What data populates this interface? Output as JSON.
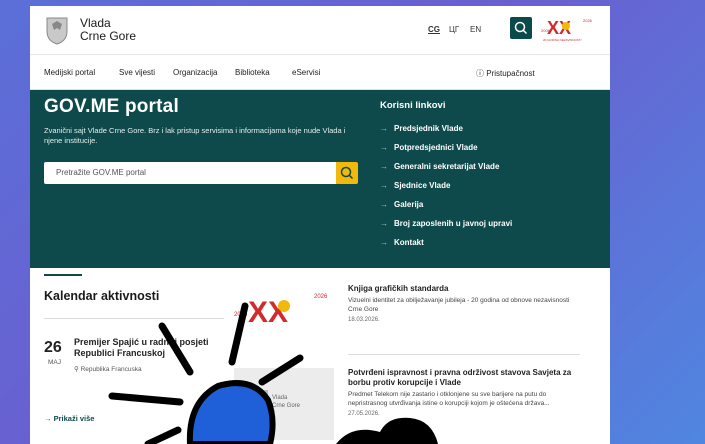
{
  "header": {
    "brand_line1": "Vlada",
    "brand_line2": "Crne Gore",
    "languages": [
      "CG",
      "ЦГ",
      "EN"
    ],
    "active_language": "CG",
    "jubilee_logo_text": "20 GODINA NEZAVISNOSTI"
  },
  "nav": {
    "items": [
      "Medijski portal",
      "Sve vijesti",
      "Organizacija",
      "Biblioteka",
      "eServisi"
    ],
    "accessibility": "Pristupačnost"
  },
  "hero": {
    "title": "GOV.ME portal",
    "description": "Zvanični sajt Vlade Crne Gore. Brz i lak pristup servisima i informacijama koje nude Vlada i njene institucije.",
    "search_placeholder": "Pretražite GOV.ME portal",
    "links_title": "Korisni linkovi",
    "links": [
      "Predsjednik Vlade",
      "Potpredsjednici Vlade",
      "Generalni sekretarijat Vlade",
      "Sjednice Vlade",
      "Galerija",
      "Broj zaposlenih u javnoj upravi",
      "Kontakt"
    ]
  },
  "calendar": {
    "title": "Kalendar aktivnosti",
    "event": {
      "day": "26",
      "month": "MAJ",
      "title": "Premijer Spajić u radnoj posjeti Republici Francuskoj",
      "location": "Republika Francuska"
    },
    "show_more": "Prikaži više"
  },
  "news": [
    {
      "title": "Knjiga grafičkih standarda",
      "description": "Vizuelni identitet za obilježavanje jubileja - 20 godina od obnove nezavisnosti Crne Gore",
      "date": "18.03.2026."
    },
    {
      "title": "Potvrđeni ispravnost i pravna održivost stavova Savjeta za borbu protiv korupcije i Vlade",
      "description": "Predmet Telekom nije zastario i otklonjene su sve barijere na putu do nepristrasnog utvrđivanja istine o korupciji kojom je oštećena država...",
      "date": "27.05.2026."
    }
  ],
  "colors": {
    "hero_bg": "#0e4a4b",
    "accent_yellow": "#f0b90b",
    "jubilee_red": "#d22b2b",
    "doodle_blue": "#1f5fd8"
  }
}
